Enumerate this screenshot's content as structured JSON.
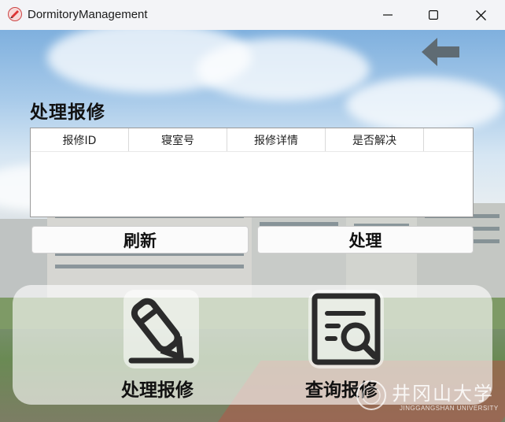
{
  "window": {
    "title": "DormitoryManagement",
    "controls": {
      "minimize": "minimize",
      "maximize": "maximize",
      "close": "close"
    }
  },
  "page": {
    "title": "处理报修",
    "back_icon": "arrow-left-icon"
  },
  "table": {
    "columns": [
      "报修ID",
      "寝室号",
      "报修详情",
      "是否解决"
    ],
    "rows": []
  },
  "actions": {
    "refresh_label": "刷新",
    "process_label": "处理"
  },
  "tiles": [
    {
      "label": "处理报修",
      "icon": "pencil-icon"
    },
    {
      "label": "查询报修",
      "icon": "document-search-icon"
    }
  ],
  "watermark": {
    "title": "井冈山大学",
    "subtitle": "JINGGANGSHAN UNIVERSITY"
  },
  "colors": {
    "icon_dark": "#2b2b2b",
    "back_arrow": "#5f6b73",
    "titlebar": "#f3f4f7"
  }
}
